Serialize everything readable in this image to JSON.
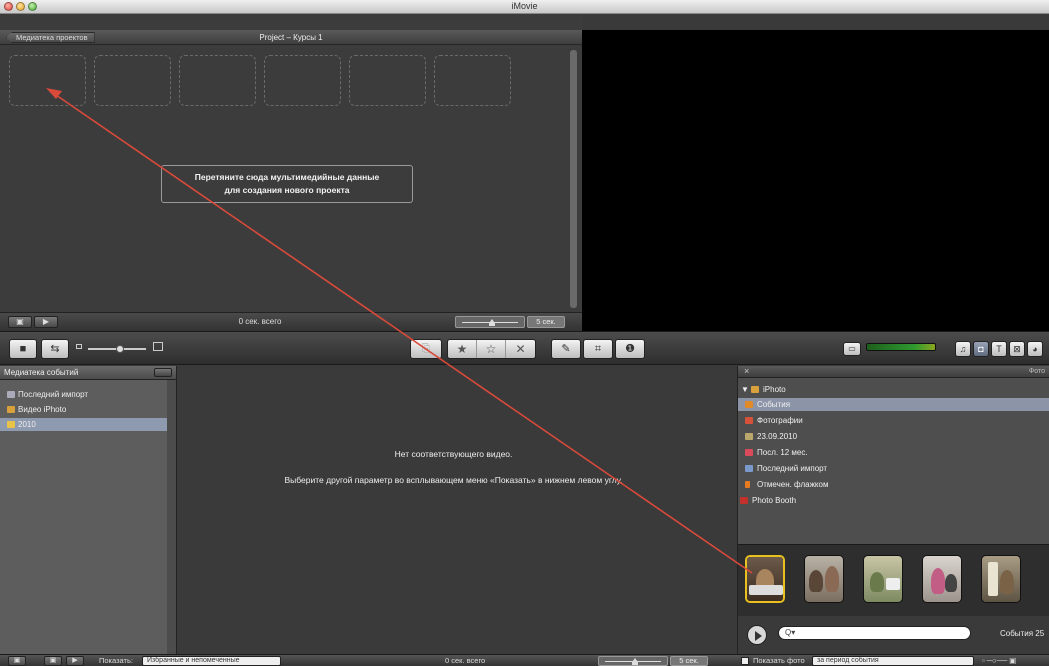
{
  "window": {
    "title": "iMovie"
  },
  "project": {
    "back_label": "Медиатека проектов",
    "title": "Project – Курсы 1",
    "drop_line1": "Перетяните сюда мультимедийные данные",
    "drop_line2": "для создания нового проекта",
    "total": "0 сек. всего",
    "zoom": "5 сек."
  },
  "event_library": {
    "title": "Медиатека событий",
    "items": [
      {
        "label": "Последний импорт",
        "icon": "film-icon"
      },
      {
        "label": "Видео iPhoto",
        "icon": "iphoto-icon"
      },
      {
        "label": "2010",
        "icon": "folder-icon"
      }
    ]
  },
  "event_browser": {
    "empty_title": "Нет соответствующего видео.",
    "empty_sub": "Выберите другой параметр во всплывающем меню «Показать» в нижнем левом углу."
  },
  "photo_browser": {
    "header": "Фото",
    "tree": [
      {
        "label": "iPhoto",
        "level": 0
      },
      {
        "label": "События",
        "level": 1
      },
      {
        "label": "Фотографии",
        "level": 1
      },
      {
        "label": "23.09.2010",
        "level": 1
      },
      {
        "label": "Посл. 12 мес.",
        "level": 1
      },
      {
        "label": "Последний импорт",
        "level": 1
      },
      {
        "label": "Отмечен. флажком",
        "level": 1
      },
      {
        "label": "Photo Booth",
        "level": 0
      }
    ],
    "count": "События 25"
  },
  "status_bar": {
    "show_label": "Показать:",
    "show_value": "Избранные и непомеченные",
    "total": "0 сек. всего",
    "zoom": "5 сек.",
    "show_photo": "Показать фото",
    "period": "за период события"
  },
  "colors": {
    "accent_selection": "#8e9aaf",
    "thumb_selected": "#e8c020",
    "arrow": "#d94a3a"
  }
}
